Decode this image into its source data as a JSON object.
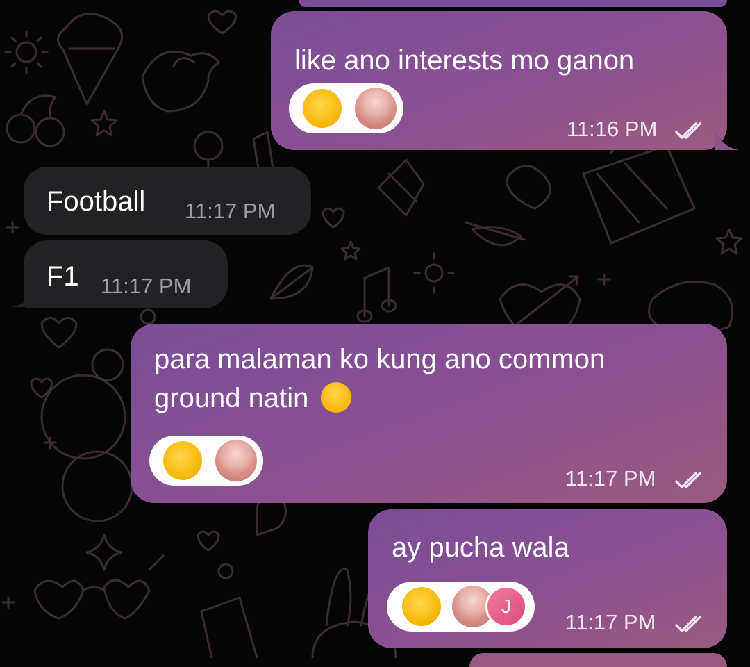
{
  "colors": {
    "background": "#050506",
    "outgoing_bubble": "#8a5190",
    "incoming_bubble": "#222224",
    "wallpaper_line": "#3a2a32"
  },
  "messages": [
    {
      "direction": "outgoing",
      "text_lines": [
        "like ano interests mo ganon"
      ],
      "time": "11:16 PM",
      "status_icon": "double-check-icon",
      "reactions": [
        {
          "type": "emoji",
          "icon": "rolling-on-floor-laughing-emoji"
        },
        {
          "type": "avatar",
          "icon": "user-avatar-pink-hair"
        }
      ]
    },
    {
      "direction": "incoming",
      "text_lines": [
        "Football"
      ],
      "time": "11:17 PM"
    },
    {
      "direction": "incoming",
      "text_lines": [
        "F1"
      ],
      "time": "11:17 PM"
    },
    {
      "direction": "outgoing",
      "text_lines": [
        "para malaman ko kung ano common",
        "ground natin"
      ],
      "trailing_emoji": "pleading-face-emoji",
      "time": "11:17 PM",
      "status_icon": "double-check-icon",
      "reactions": [
        {
          "type": "emoji",
          "icon": "rolling-on-floor-laughing-emoji"
        },
        {
          "type": "avatar",
          "icon": "user-avatar-pink-hair"
        }
      ]
    },
    {
      "direction": "outgoing",
      "text_lines": [
        "ay pucha wala"
      ],
      "time": "11:17 PM",
      "status_icon": "double-check-icon",
      "reactions": [
        {
          "type": "emoji",
          "icon": "rolling-on-floor-laughing-emoji"
        },
        {
          "type": "avatar",
          "icon": "user-avatar-pink-hair"
        },
        {
          "type": "initial",
          "label": "J"
        }
      ]
    }
  ]
}
